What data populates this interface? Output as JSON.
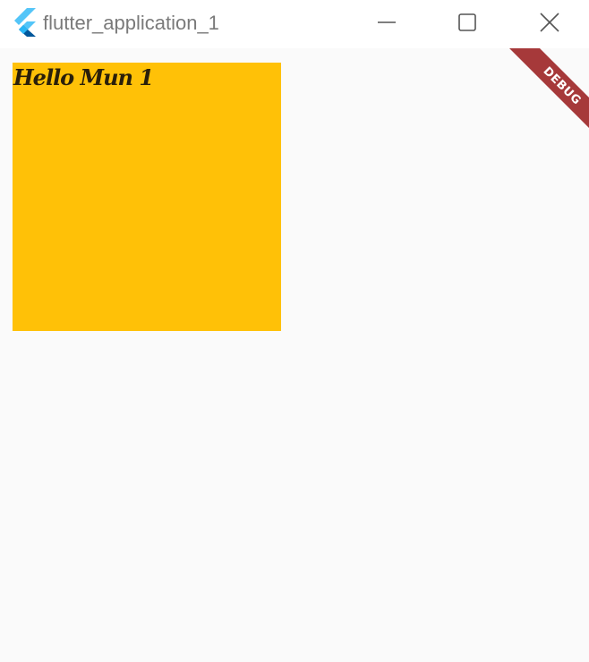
{
  "window": {
    "title": "flutter_application_1",
    "app_icon": "flutter-logo-icon",
    "controls": {
      "minimize": "minimize-icon",
      "maximize": "maximize-icon",
      "close": "close-icon"
    }
  },
  "main": {
    "box_text": "Hello Mun 1",
    "box_color": "#ffc107",
    "background_color": "#fafafa"
  },
  "debug_banner": {
    "label": "DEBUG",
    "color": "#a6393a"
  }
}
